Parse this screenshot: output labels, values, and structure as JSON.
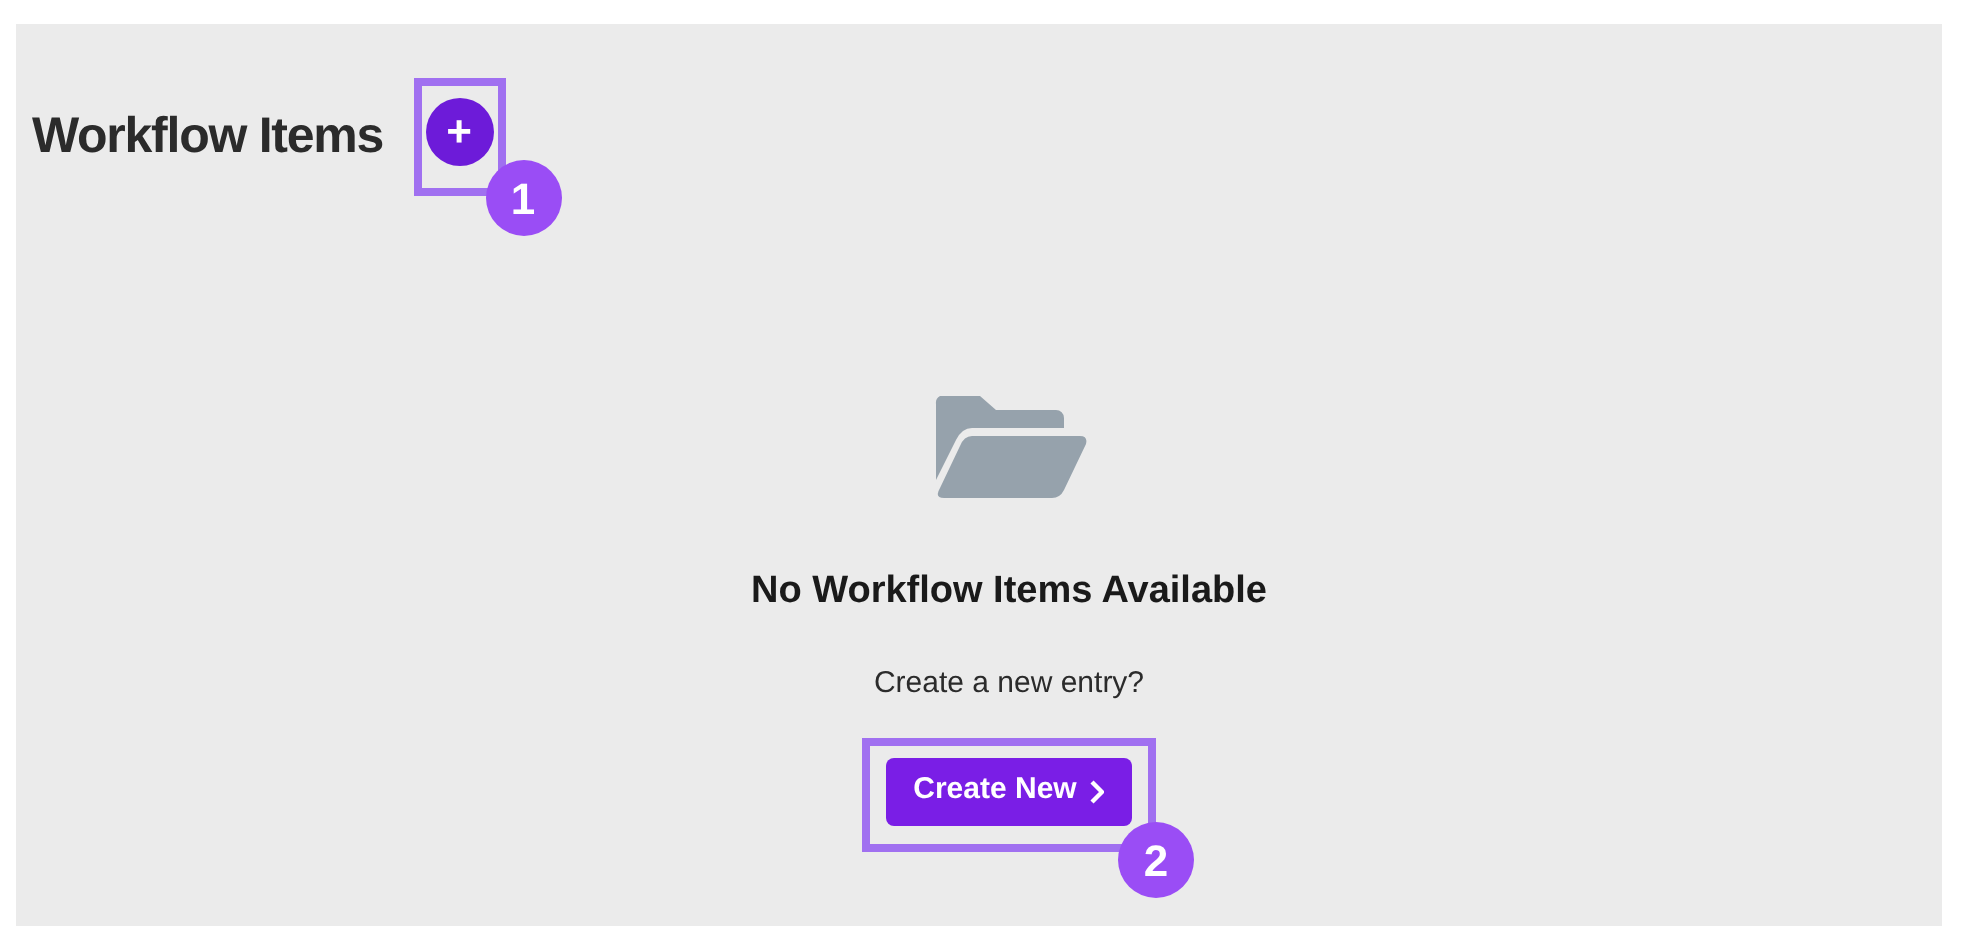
{
  "header": {
    "title": "Workflow Items",
    "add_button": {
      "label": "+",
      "callout": "1"
    }
  },
  "empty_state": {
    "heading": "No Workflow Items Available",
    "prompt": "Create a new entry?",
    "button": {
      "label": "Create New",
      "callout": "2"
    }
  }
}
